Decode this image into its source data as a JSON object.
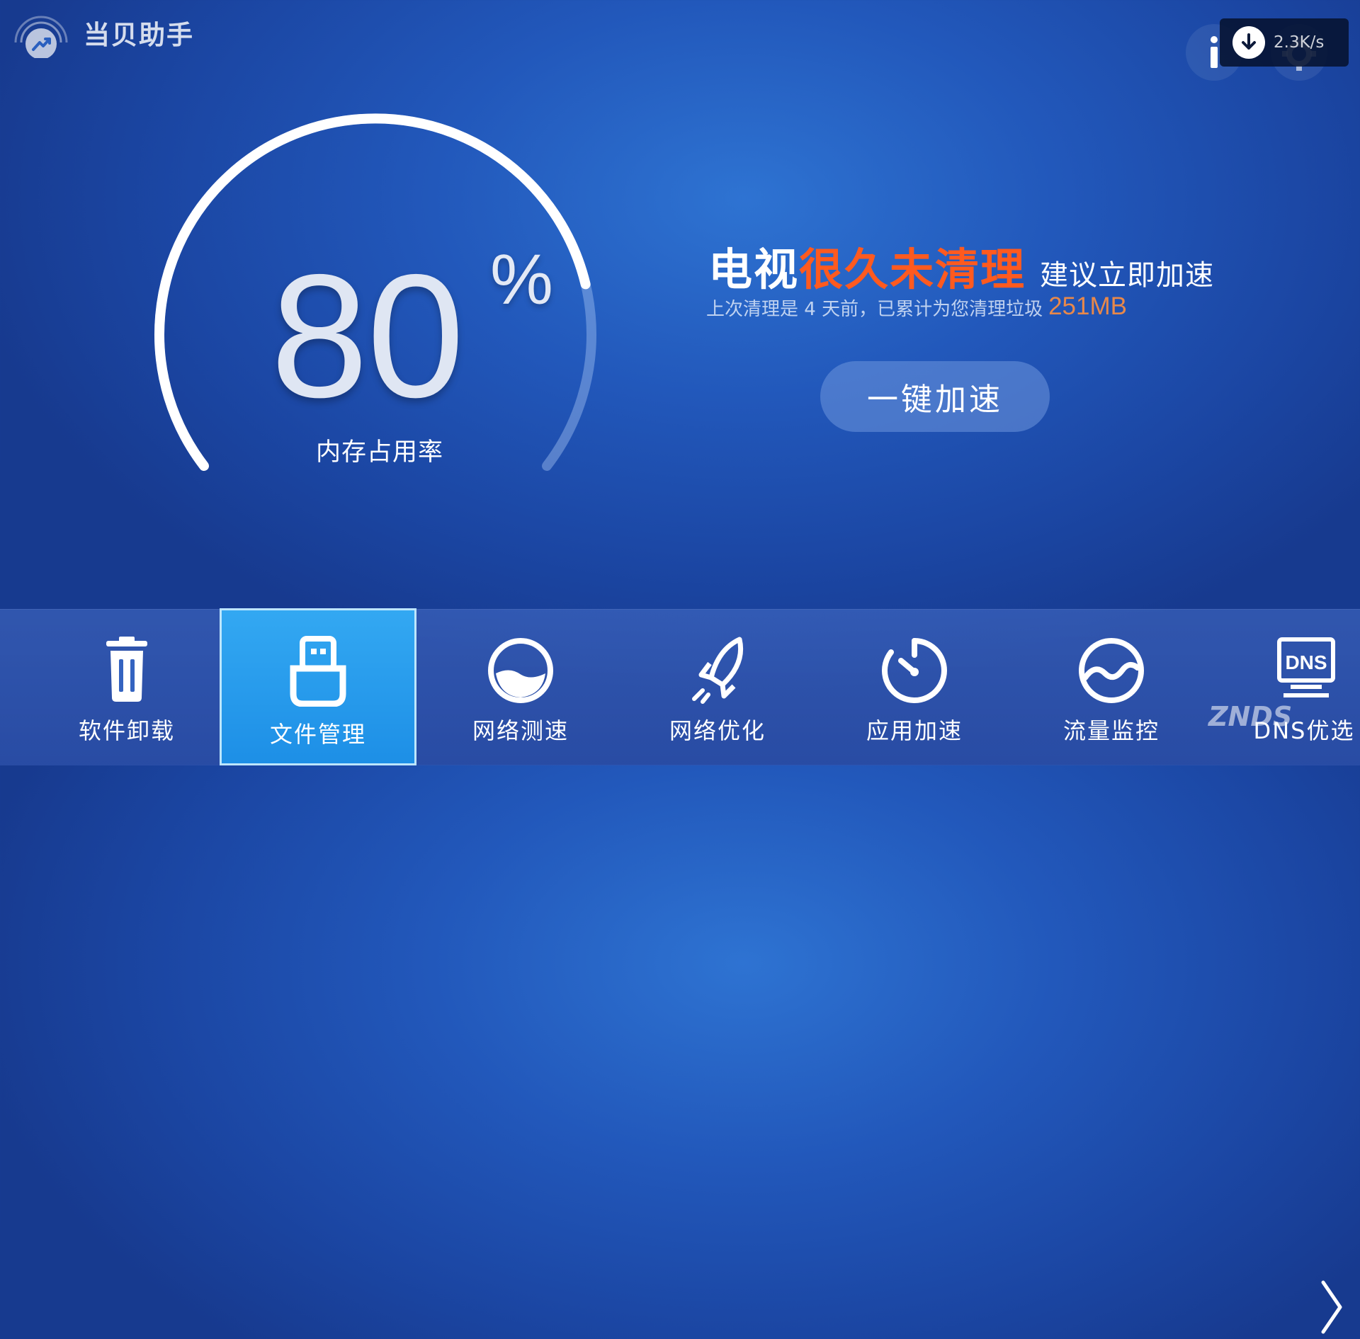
{
  "app": {
    "title": "当贝助手"
  },
  "topbar": {
    "speed": "2.3K/s",
    "info_icon": "info-icon",
    "settings_icon": "gear-icon",
    "download_icon": "arrow-down-icon"
  },
  "gauge": {
    "value_text": "80",
    "unit": "%",
    "label": "内存占用率",
    "fill_percent": 80
  },
  "status": {
    "headline_prefix": "电视",
    "headline_highlight": "很久未清理",
    "headline_suffix": "建议立即加速",
    "summary": "上次清理是 4 天前，已累计为您清理垃圾",
    "cleaned_amount": "251MB",
    "boost_button": "一键加速"
  },
  "colors": {
    "accent_orange": "#ff5a1f",
    "amount_orange": "#e8884a",
    "active_tile": "#1d8fe6"
  },
  "toolbar": {
    "items": [
      {
        "label": "软件卸载",
        "icon": "trash-icon",
        "active": false
      },
      {
        "label": "文件管理",
        "icon": "usb-drive-icon",
        "active": true
      },
      {
        "label": "网络测速",
        "icon": "speed-bowl-icon",
        "active": false
      },
      {
        "label": "网络优化",
        "icon": "rocket-icon",
        "active": false
      },
      {
        "label": "应用加速",
        "icon": "timer-icon",
        "active": false
      },
      {
        "label": "流量监控",
        "icon": "wave-circle-icon",
        "active": false
      },
      {
        "label": "DNS优选",
        "icon": "dns-monitor-icon",
        "active": false
      }
    ],
    "next_icon": "chevron-right-icon"
  },
  "watermark": "ZNDS"
}
